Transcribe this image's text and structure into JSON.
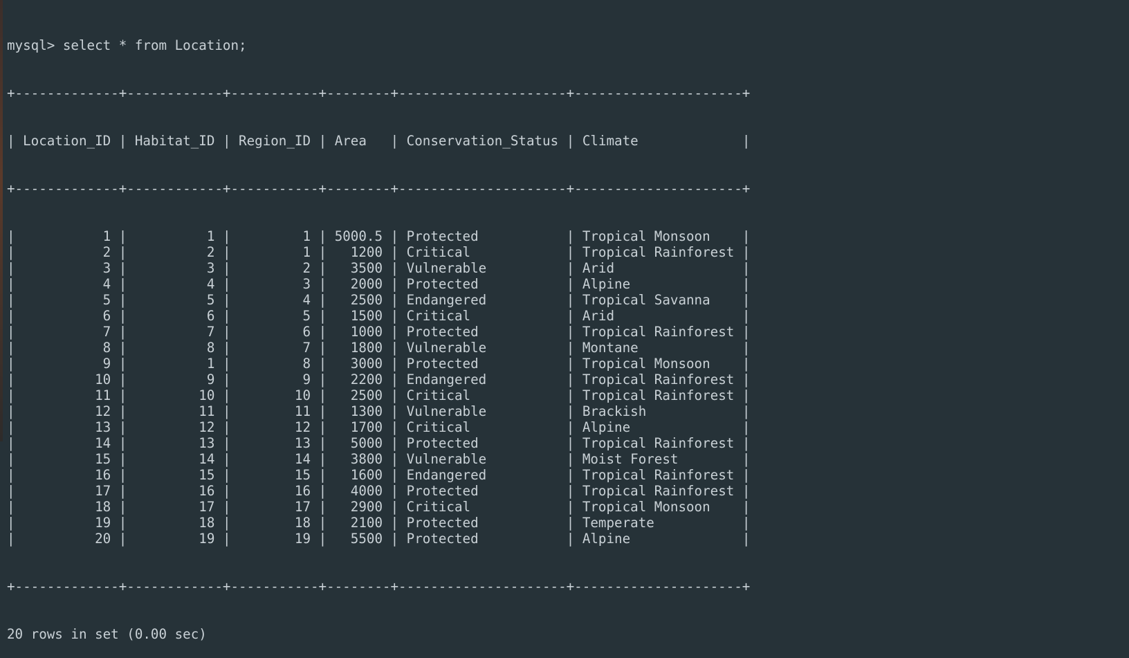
{
  "terminal": {
    "prompt": "mysql>",
    "command": "select * from Location;",
    "columns": [
      "Location_ID",
      "Habitat_ID",
      "Region_ID",
      "Area",
      "Conservation_Status",
      "Climate"
    ],
    "align": [
      "right",
      "right",
      "right",
      "right",
      "left",
      "left"
    ],
    "rows": [
      [
        "1",
        "1",
        "1",
        "5000.5",
        "Protected",
        "Tropical Monsoon"
      ],
      [
        "2",
        "2",
        "1",
        "1200",
        "Critical",
        "Tropical Rainforest"
      ],
      [
        "3",
        "3",
        "2",
        "3500",
        "Vulnerable",
        "Arid"
      ],
      [
        "4",
        "4",
        "3",
        "2000",
        "Protected",
        "Alpine"
      ],
      [
        "5",
        "5",
        "4",
        "2500",
        "Endangered",
        "Tropical Savanna"
      ],
      [
        "6",
        "6",
        "5",
        "1500",
        "Critical",
        "Arid"
      ],
      [
        "7",
        "7",
        "6",
        "1000",
        "Protected",
        "Tropical Rainforest"
      ],
      [
        "8",
        "8",
        "7",
        "1800",
        "Vulnerable",
        "Montane"
      ],
      [
        "9",
        "1",
        "8",
        "3000",
        "Protected",
        "Tropical Monsoon"
      ],
      [
        "10",
        "9",
        "9",
        "2200",
        "Endangered",
        "Tropical Rainforest"
      ],
      [
        "11",
        "10",
        "10",
        "2500",
        "Critical",
        "Tropical Rainforest"
      ],
      [
        "12",
        "11",
        "11",
        "1300",
        "Vulnerable",
        "Brackish"
      ],
      [
        "13",
        "12",
        "12",
        "1700",
        "Critical",
        "Alpine"
      ],
      [
        "14",
        "13",
        "13",
        "5000",
        "Protected",
        "Tropical Rainforest"
      ],
      [
        "15",
        "14",
        "14",
        "3800",
        "Vulnerable",
        "Moist Forest"
      ],
      [
        "16",
        "15",
        "15",
        "1600",
        "Endangered",
        "Tropical Rainforest"
      ],
      [
        "17",
        "16",
        "16",
        "4000",
        "Protected",
        "Tropical Rainforest"
      ],
      [
        "18",
        "17",
        "17",
        "2900",
        "Critical",
        "Tropical Monsoon"
      ],
      [
        "19",
        "18",
        "18",
        "2100",
        "Protected",
        "Temperate"
      ],
      [
        "20",
        "19",
        "19",
        "5500",
        "Protected",
        "Alpine"
      ]
    ],
    "footer": "20 rows in set (0.00 sec)"
  },
  "colors": {
    "background": "#263238",
    "text": "#c9d1d6"
  }
}
